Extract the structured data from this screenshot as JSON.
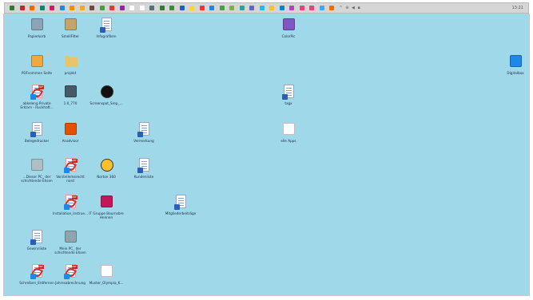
{
  "taskbar": {
    "icons": [
      {
        "name": "tb-icon-1",
        "color": "#2e7d32"
      },
      {
        "name": "tb-icon-2",
        "color": "#c62828"
      },
      {
        "name": "tb-icon-3",
        "color": "#ef6c00"
      },
      {
        "name": "tb-icon-4",
        "color": "#00897b"
      },
      {
        "name": "tb-icon-5",
        "color": "#d81b60"
      },
      {
        "name": "tb-icon-6",
        "color": "#1e88e5"
      },
      {
        "name": "tb-icon-7",
        "color": "#fb8c00"
      },
      {
        "name": "tb-icon-8",
        "color": "#f9a825"
      },
      {
        "name": "tb-icon-9",
        "color": "#6d4c41"
      },
      {
        "name": "tb-icon-10",
        "color": "#43a047"
      },
      {
        "name": "tb-icon-11",
        "color": "#e53935"
      },
      {
        "name": "tb-icon-12",
        "color": "#8e24aa"
      },
      {
        "name": "tb-icon-13",
        "color": "#ffffff"
      },
      {
        "name": "tb-icon-14",
        "color": "#ffffff"
      },
      {
        "name": "tb-icon-15",
        "color": "#546e7a"
      },
      {
        "name": "tb-icon-16",
        "color": "#2e7d32"
      },
      {
        "name": "tb-icon-17",
        "color": "#388e3c"
      },
      {
        "name": "tb-icon-18",
        "color": "#1565c0"
      },
      {
        "name": "tb-icon-19",
        "color": "#fdd835"
      },
      {
        "name": "tb-icon-20",
        "color": "#e53935"
      },
      {
        "name": "tb-icon-21",
        "color": "#1e88e5"
      },
      {
        "name": "tb-icon-22",
        "color": "#43a047"
      },
      {
        "name": "tb-icon-23",
        "color": "#7cb342"
      },
      {
        "name": "tb-icon-24",
        "color": "#26a69a"
      },
      {
        "name": "tb-icon-25",
        "color": "#5c6bc0"
      },
      {
        "name": "tb-icon-26",
        "color": "#29b6f6"
      },
      {
        "name": "tb-icon-27",
        "color": "#fbc02d"
      },
      {
        "name": "tb-icon-28",
        "color": "#0288d1"
      },
      {
        "name": "tb-icon-29",
        "color": "#ab47bc"
      },
      {
        "name": "tb-icon-30",
        "color": "#ec407a"
      },
      {
        "name": "tb-icon-31",
        "color": "#ec407a"
      },
      {
        "name": "tb-icon-32",
        "color": "#42a5f5"
      },
      {
        "name": "tb-icon-33",
        "color": "#ef6c00"
      }
    ],
    "tray": "^ ⊕ ◀ ▪",
    "time": "13:21"
  },
  "desktop": {
    "icons": [
      {
        "name": "Papierkorb",
        "label": "Papierkorb",
        "type": "app",
        "color": "#8fa3b8"
      },
      {
        "name": "OneNote",
        "label": "SmellFilter",
        "type": "app",
        "color": "#c9a36a"
      },
      {
        "name": "Infografik",
        "label": "Infografiken",
        "type": "word"
      },
      {
        "name": "ColorPic",
        "label": "ColorPic",
        "type": "app",
        "color": "#7e57c2"
      },
      {
        "name": "PDF-Seiten",
        "label": "PDFsommen Seite",
        "type": "app",
        "color": "#f2a93b"
      },
      {
        "name": "projekt",
        "label": "projekt",
        "type": "folder"
      },
      {
        "name": "Digitalbox",
        "label": "Digitalbox",
        "type": "app",
        "color": "#1e88e5"
      },
      {
        "name": "Ruckung",
        "label": "abkeleng Private Erklarn - Ruckhaft...",
        "type": "pdf"
      },
      {
        "name": "photo1",
        "label": "1.0_770",
        "type": "app",
        "color": "#455a64"
      },
      {
        "name": "Screenshot",
        "label": "Screenspot_Srep_...",
        "type": "circle",
        "color": "#111111"
      },
      {
        "name": "tagx",
        "label": "tagx",
        "type": "word"
      },
      {
        "name": "Belegedrucker",
        "label": "Belegedrucker",
        "type": "word"
      },
      {
        "name": "Anadvisor",
        "label": "Anadvisor",
        "type": "app",
        "color": "#e65100"
      },
      {
        "name": "Vermerkung",
        "label": "Vermerkung",
        "type": "word"
      },
      {
        "name": "elite-Apps",
        "label": "elle Apps",
        "type": "app",
        "color": "#ffffff"
      },
      {
        "name": "Dieser-PC",
        "label": "...Dieser PC_ der schichtende Ehsen",
        "type": "app",
        "color": "#b0bec5"
      },
      {
        "name": "Vorstellung",
        "label": "Vorstellemerecht nord",
        "type": "pdf"
      },
      {
        "name": "Norton",
        "label": "Norton 360",
        "type": "circle",
        "color": "#fbc02d"
      },
      {
        "name": "Kundenliste",
        "label": "Kundenliste",
        "type": "word"
      },
      {
        "name": "Installation",
        "label": "Installation_Instrue...",
        "type": "pdf"
      },
      {
        "name": "Skype-Gruppe",
        "label": "IT Gruppe Bournsbre Hennen",
        "type": "app",
        "color": "#c2185b"
      },
      {
        "name": "Mitgliederbeitraege",
        "label": "Mitgliederbeiträge",
        "type": "word"
      },
      {
        "name": "Tabellen",
        "label": "Gewinnliste",
        "type": "word"
      },
      {
        "name": "Mein-PC",
        "label": "Mein PC_ der schichtende Ehsen",
        "type": "app",
        "color": "#90a4ae"
      },
      {
        "name": "Sitzungs-Infomaterial",
        "label": "Schreiben_Entfernen",
        "type": "pdf"
      },
      {
        "name": "Rechnungsvorlage",
        "label": "Jahresabrechnung",
        "type": "pdf"
      },
      {
        "name": "Muster-Olympia",
        "label": "Muster_Olympia_K...",
        "type": "app",
        "color": "#ffffff"
      }
    ]
  }
}
